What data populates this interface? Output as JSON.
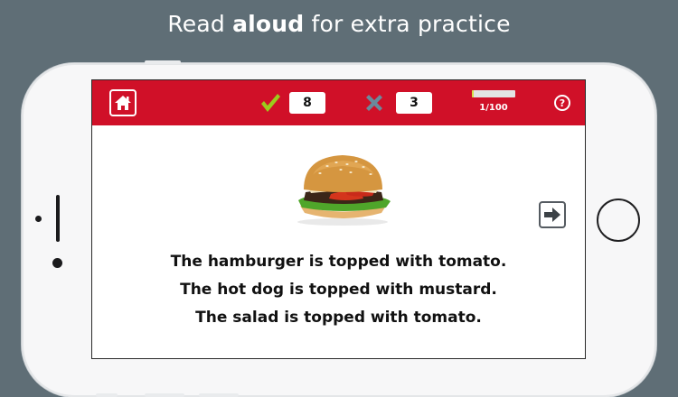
{
  "headline": {
    "prefix": "Read ",
    "emphasis": "aloud",
    "suffix": " for extra practice"
  },
  "toolbar": {
    "home_icon": "home-icon",
    "correct_icon": "check-icon",
    "correct_count": "8",
    "wrong_icon": "x-icon",
    "wrong_count": "3",
    "progress_fraction": 0.01,
    "progress_text": "1/100",
    "help_label": "?"
  },
  "content": {
    "image": "hamburger-image",
    "next_icon": "arrow-right-icon",
    "sentences": [
      "The hamburger is topped with tomato.",
      "The hot dog is topped with mustard.",
      "The salad is topped with tomato."
    ]
  },
  "colors": {
    "background": "#5f6e76",
    "toolbar": "#d01028",
    "check": "#9ccc1c",
    "x": "#6a8a9c",
    "progress_fill": "#d6e04a"
  }
}
